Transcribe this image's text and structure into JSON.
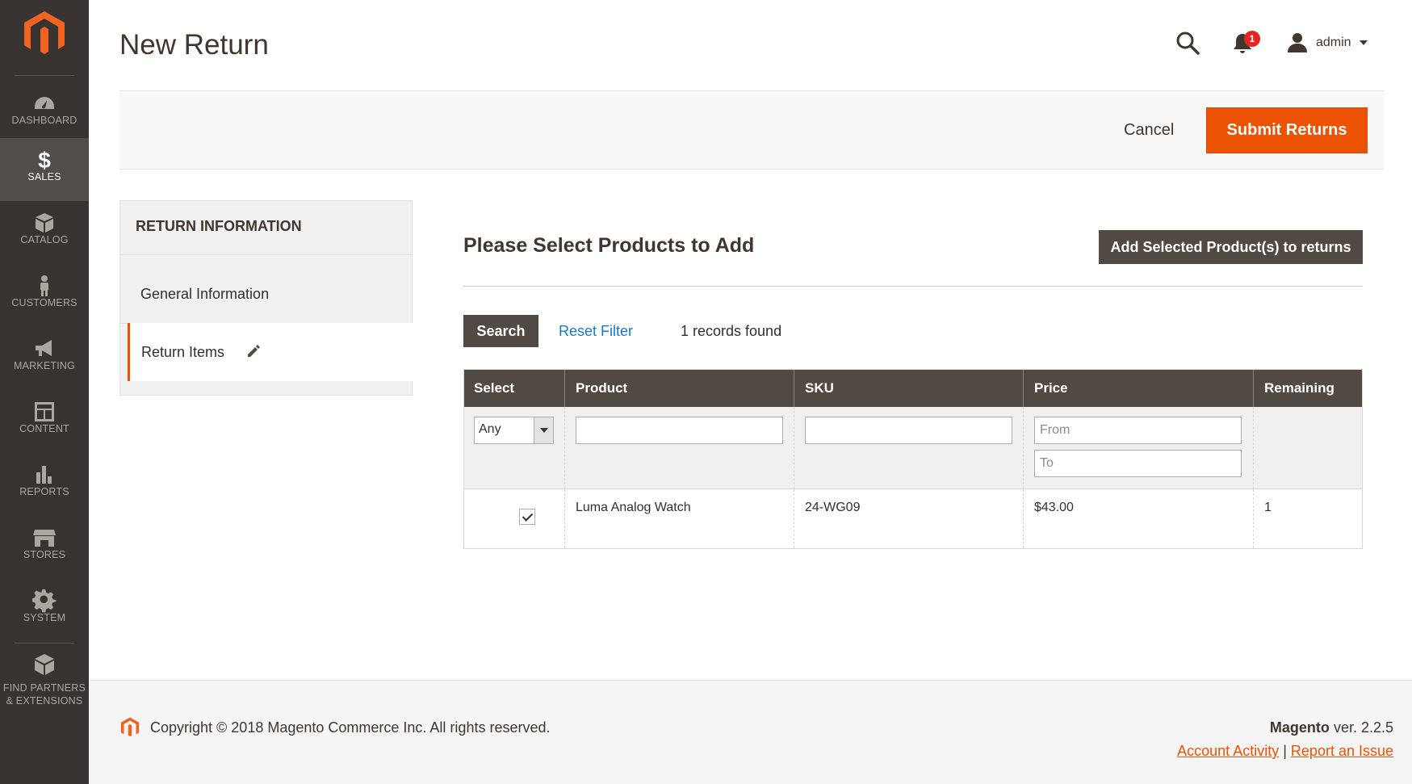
{
  "sidebar": {
    "logo": "magento-logo",
    "items": [
      {
        "label": "DASHBOARD",
        "icon": "speedometer-icon"
      },
      {
        "label": "SALES",
        "icon": "dollar-icon",
        "active": true
      },
      {
        "label": "CATALOG",
        "icon": "box-icon"
      },
      {
        "label": "CUSTOMERS",
        "icon": "person-icon"
      },
      {
        "label": "MARKETING",
        "icon": "megaphone-icon"
      },
      {
        "label": "CONTENT",
        "icon": "layout-icon"
      },
      {
        "label": "REPORTS",
        "icon": "bar-chart-icon"
      },
      {
        "label": "STORES",
        "icon": "storefront-icon"
      },
      {
        "label": "SYSTEM",
        "icon": "gear-icon"
      },
      {
        "label_line1": "FIND PARTNERS",
        "label_line2": "& EXTENSIONS",
        "icon": "package-icon"
      }
    ]
  },
  "header": {
    "title": "New Return",
    "notification_count": "1",
    "user": "admin"
  },
  "actions": {
    "cancel": "Cancel",
    "submit": "Submit Returns"
  },
  "tabs": {
    "heading": "RETURN INFORMATION",
    "general": "General Information",
    "return_items": "Return Items"
  },
  "main": {
    "section_title": "Please Select Products to Add",
    "add_button": "Add Selected Product(s) to returns",
    "search_button": "Search",
    "reset_filter": "Reset Filter",
    "records_found": "1 records found"
  },
  "grid": {
    "columns": [
      "Select",
      "Product",
      "SKU",
      "Price",
      "Remaining"
    ],
    "filters": {
      "select_value": "Any",
      "price_from_placeholder": "From",
      "price_to_placeholder": "To"
    },
    "rows": [
      {
        "selected": true,
        "product": "Luma Analog Watch",
        "sku": "24-WG09",
        "price": "$43.00",
        "remaining": "1"
      }
    ]
  },
  "footer": {
    "copyright": "Copyright © 2018 Magento Commerce Inc. All rights reserved.",
    "brand": "Magento",
    "version": "ver. 2.2.5",
    "link_activity": "Account Activity",
    "separator": "|",
    "link_issue": "Report an Issue"
  },
  "colors": {
    "accent": "#eb5202",
    "sidebar_bg": "#373330",
    "dark_button": "#514943",
    "link": "#1979c3"
  }
}
